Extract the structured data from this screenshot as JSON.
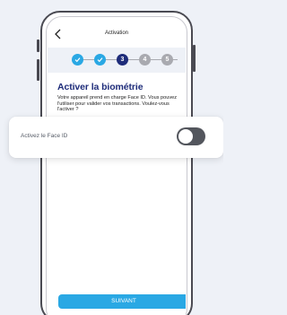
{
  "header": {
    "title": "Activation",
    "back_icon": "chevron-left-icon"
  },
  "stepper": {
    "steps": [
      {
        "label": "",
        "state": "done"
      },
      {
        "label": "",
        "state": "done"
      },
      {
        "label": "3",
        "state": "current"
      },
      {
        "label": "4",
        "state": "todo"
      },
      {
        "label": "5",
        "state": "todo"
      }
    ]
  },
  "content": {
    "heading": "Activer la biométrie",
    "description": "Votre appareil prend en charge Face ID. Vous pouvez l'utiliser pour valider vos transactions. Voulez-vous l'activer ?"
  },
  "setting": {
    "label": "Activez le Face ID",
    "enabled": false
  },
  "actions": {
    "submit_label": "SUIVANT"
  },
  "colors": {
    "accent": "#2aa8e4",
    "primary_dark": "#1e2c7a",
    "inactive": "#a9aab0",
    "toggle_off": "#53565d",
    "background": "#eef1f7"
  }
}
